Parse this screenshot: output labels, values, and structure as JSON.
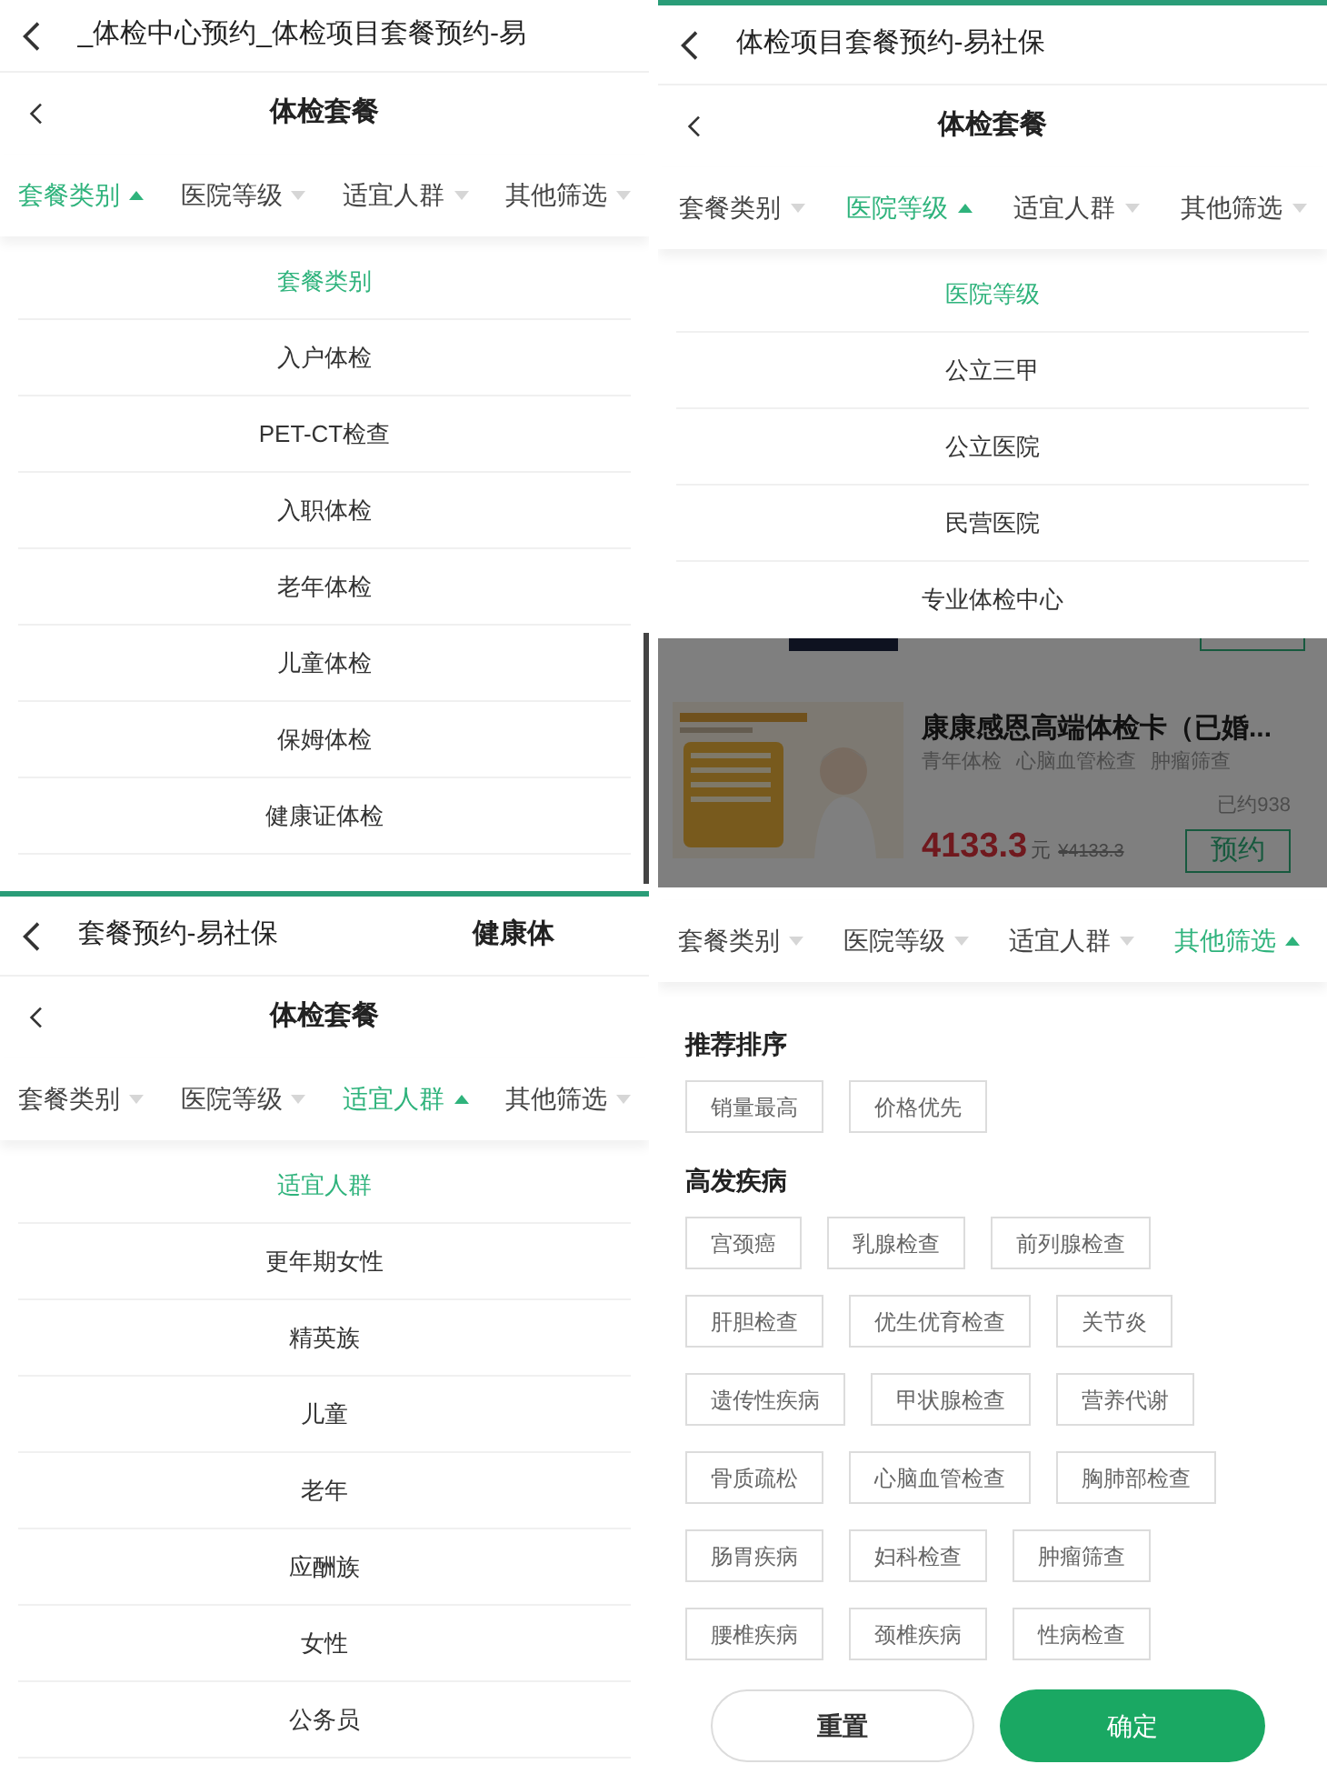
{
  "panels": [
    {
      "kind": "dropdown",
      "accent_line": false,
      "scroll_bar": true,
      "browser_bar": {
        "title": "_体检中心预约_体检项目套餐预约-易"
      },
      "page_title": "体检套餐",
      "filters": [
        {
          "label": "套餐类别",
          "selected": true
        },
        {
          "label": "医院等级",
          "selected": false
        },
        {
          "label": "适宜人群",
          "selected": false
        },
        {
          "label": "其他筛选",
          "selected": false
        }
      ],
      "menu": {
        "header": "套餐类别",
        "items": [
          "入户体检",
          "PET-CT检查",
          "入职体检",
          "老年体检",
          "儿童体检",
          "保姆体检",
          "健康证体检"
        ]
      }
    },
    {
      "kind": "dropdown",
      "accent_line": true,
      "scroll_bar": false,
      "browser_bar": {
        "title": "体检项目套餐预约-易社保"
      },
      "page_title": "体检套餐",
      "filters": [
        {
          "label": "套餐类别",
          "selected": false
        },
        {
          "label": "医院等级",
          "selected": true
        },
        {
          "label": "适宜人群",
          "selected": false
        },
        {
          "label": "其他筛选",
          "selected": false
        }
      ],
      "menu": {
        "header": "医院等级",
        "items": [
          "公立三甲",
          "公立医院",
          "民营医院",
          "专业体检中心"
        ]
      },
      "dimmed_card": {
        "image": {
          "kind": "picture"
        },
        "title": "康康感恩高端体检卡（已婚...",
        "tags": [
          "青年体检",
          "心脑血管检查",
          "肿瘤筛查"
        ],
        "booked": "已约938",
        "price": "4133.3",
        "unit": "元",
        "original_price": "¥4133.3",
        "button": "预约"
      }
    },
    {
      "kind": "dropdown",
      "accent_line": true,
      "scroll_bar": false,
      "browser_bar": {
        "title": "套餐预约-易社保",
        "extra": "健康体"
      },
      "page_title": "体检套餐",
      "filters": [
        {
          "label": "套餐类别",
          "selected": false
        },
        {
          "label": "医院等级",
          "selected": false
        },
        {
          "label": "适宜人群",
          "selected": true
        },
        {
          "label": "其他筛选",
          "selected": false
        }
      ],
      "menu": {
        "header": "适宜人群",
        "items": [
          "更年期女性",
          "精英族",
          "儿童",
          "老年",
          "应酬族",
          "女性",
          "公务员"
        ]
      }
    },
    {
      "kind": "filters",
      "filters": [
        {
          "label": "套餐类别",
          "selected": false
        },
        {
          "label": "医院等级",
          "selected": false
        },
        {
          "label": "适宜人群",
          "selected": false
        },
        {
          "label": "其他筛选",
          "selected": true
        }
      ],
      "sections": [
        {
          "title": "推荐排序",
          "chip_rows": [
            [
              "销量最高",
              "价格优先"
            ]
          ]
        },
        {
          "title": "高发疾病",
          "chip_rows": [
            [
              "宫颈癌",
              "乳腺检查",
              "前列腺检查"
            ],
            [
              "肝胆检查",
              "优生优育检查",
              "关节炎"
            ],
            [
              "遗传性疾病",
              "甲状腺检查",
              "营养代谢"
            ],
            [
              "骨质疏松",
              "心脑血管检查",
              "胸肺部检查"
            ],
            [
              "肠胃疾病",
              "妇科检查",
              "肿瘤筛查"
            ],
            [
              "腰椎疾病",
              "颈椎疾病",
              "性病检查"
            ]
          ]
        }
      ],
      "buttons": {
        "reset": "重置",
        "confirm": "确定"
      }
    }
  ]
}
